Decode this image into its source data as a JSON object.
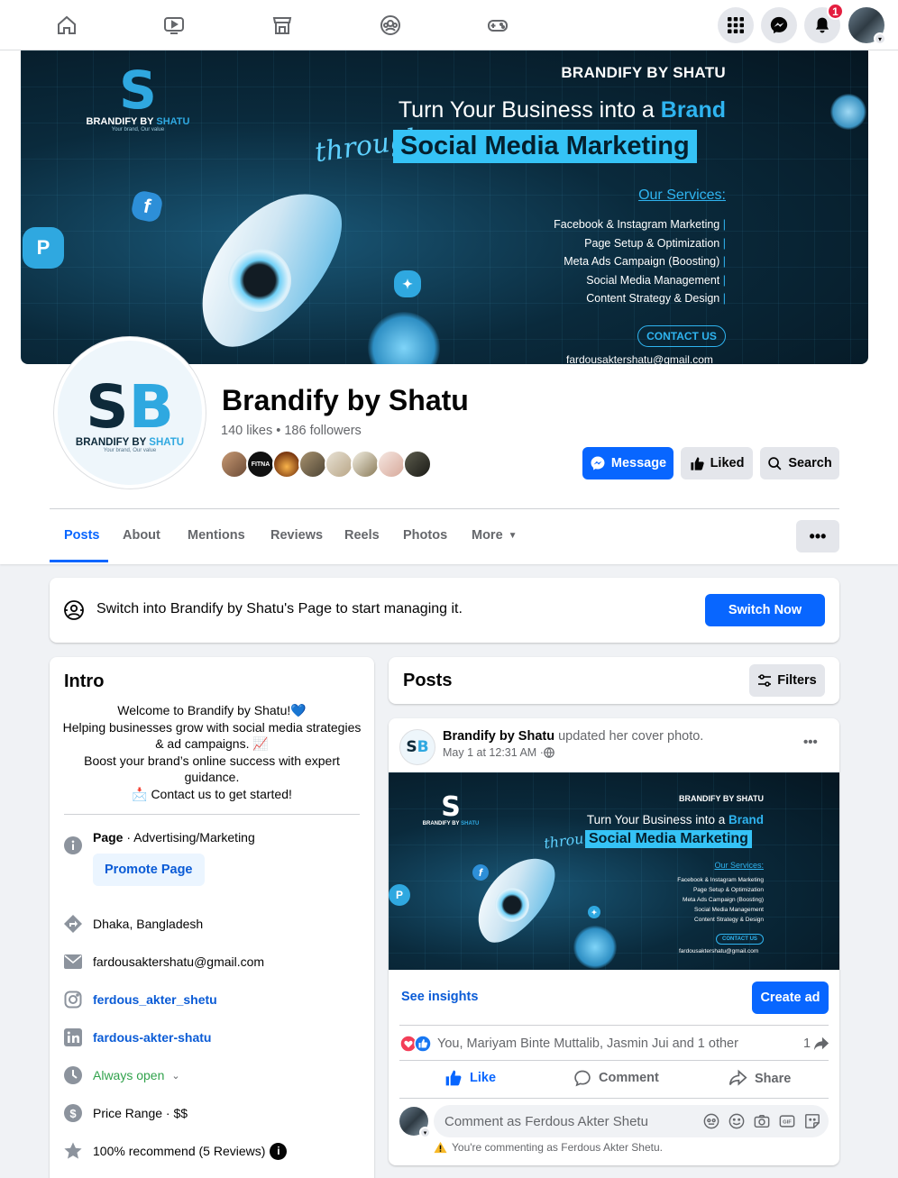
{
  "topnav": {
    "items": [
      "home-icon",
      "video-icon",
      "marketplace-icon",
      "groups-icon",
      "gaming-icon"
    ],
    "notification_count": "1"
  },
  "cover": {
    "logo_mark": "S",
    "logo_name_a": "BRANDIFY BY ",
    "logo_name_b": "SHATU",
    "logo_tag": "Your brand, Our value",
    "brand": "BRANDIFY BY SHATU",
    "headline_a": "Turn Your Business into a ",
    "headline_b": "Brand",
    "through": "through",
    "smm": "Social Media Marketing",
    "services_title": "Our Services:",
    "services": [
      "Facebook & Instagram Marketing",
      "Page Setup & Optimization",
      "Meta Ads Campaign (Boosting)",
      "Social Media Management",
      "Content Strategy & Design"
    ],
    "contact": "CONTACT US",
    "email": "fardousaktershatu@gmail.com"
  },
  "page": {
    "name": "Brandify by Shatu",
    "stats": "140 likes • 186 followers",
    "avatar_name_a": "BRANDIFY BY ",
    "avatar_name_b": "SHATU",
    "avatar_tag": "Your brand, Our value",
    "follower_avatar_text": "FITNA"
  },
  "buttons": {
    "message": "Message",
    "liked": "Liked",
    "search": "Search"
  },
  "tabs": [
    "Posts",
    "About",
    "Mentions",
    "Reviews",
    "Reels",
    "Photos",
    "More"
  ],
  "switch_banner": {
    "text": "Switch into Brandify by Shatu's Page to start managing it.",
    "button": "Switch Now"
  },
  "intro": {
    "title": "Intro",
    "bio": [
      "Welcome to Brandify by Shatu!💙",
      "Helping businesses grow with social media strategies",
      "& ad campaigns. 📈",
      "Boost your brand’s online success with expert",
      "guidance.",
      "📩 Contact us to get started!"
    ],
    "page_label": "Page",
    "page_category": " · Advertising/Marketing",
    "promote": "Promote Page",
    "location": "Dhaka, Bangladesh",
    "email": "fardousaktershatu@gmail.com",
    "instagram": "ferdous_akter_shetu",
    "linkedin": "fardous-akter-shatu",
    "hours": "Always open",
    "price": "Price Range · $$",
    "recommend": "100% recommend (5 Reviews)"
  },
  "posts_header": {
    "title": "Posts",
    "filters": "Filters"
  },
  "post": {
    "author": "Brandify by Shatu",
    "action": " updated her cover photo.",
    "date": "May 1 at 12:31 AM · ",
    "see_insights": "See insights",
    "create_ad": "Create ad",
    "reactions": "You, Mariyam Binte Muttalib, Jasmin Jui and 1 other",
    "share_count": "1",
    "like": "Like",
    "comment": "Comment",
    "share": "Share",
    "comment_placeholder": "Comment as Ferdous Akter Shetu",
    "commenting_note": "You're commenting as Ferdous Akter Shetu."
  },
  "colors": {
    "accent": "#0866ff",
    "cover_cyan": "#35c3f6",
    "badge_red": "#e41e3f"
  }
}
